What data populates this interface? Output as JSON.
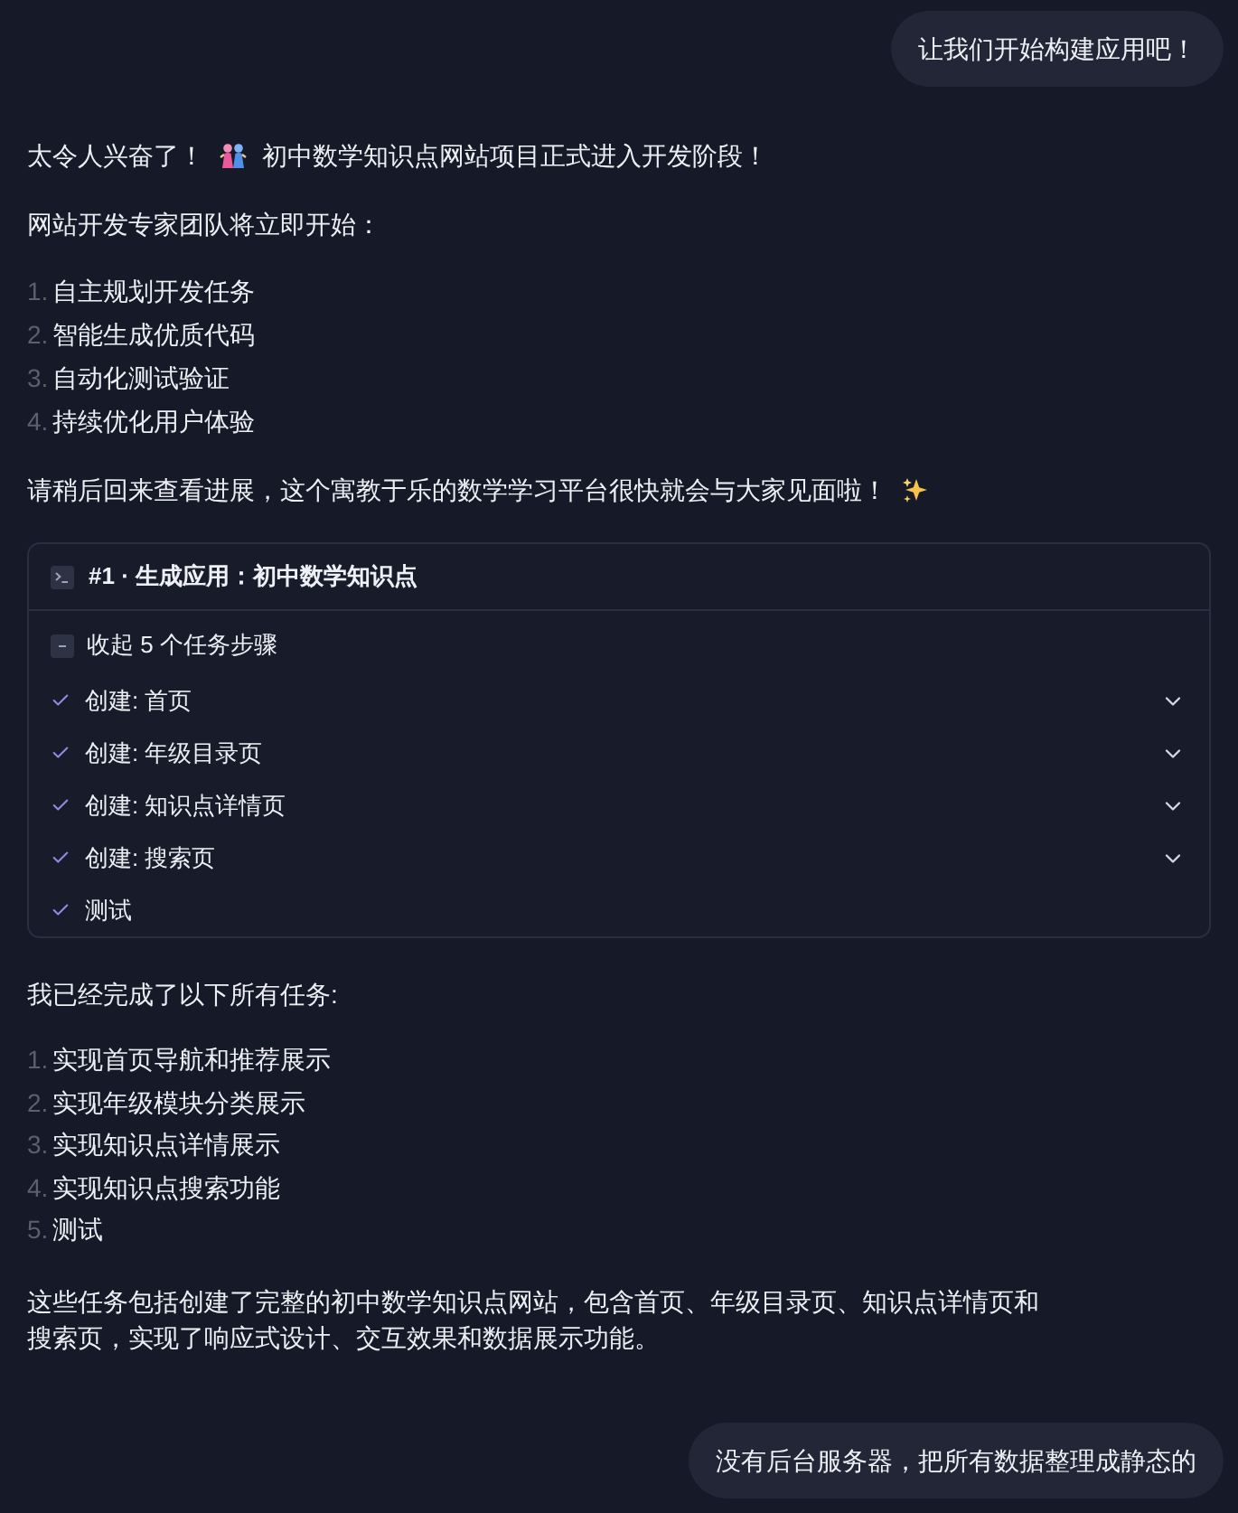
{
  "user_message": {
    "text": "让我们开始构建应用吧！"
  },
  "reply": {
    "intro": {
      "before": "太令人兴奋了！",
      "after": "初中数学知识点网站项目正式进入开发阶段！"
    },
    "team_line": "网站开发专家团队将立即开始：",
    "plan": [
      {
        "number": "1.",
        "text": "自主规划开发任务"
      },
      {
        "number": "2.",
        "text": "智能生成优质代码"
      },
      {
        "number": "3.",
        "text": "自动化测试验证"
      },
      {
        "number": "4.",
        "text": "持续优化用户体验"
      }
    ],
    "outro": "请稍后回来查看进展，这个寓教于乐的数学学习平台很快就会与大家见面啦！"
  },
  "task_card": {
    "title": "#1 · 生成应用：初中数学知识点",
    "toggle": {
      "label": "收起 5 个任务步骤",
      "expanded": true
    },
    "steps": [
      {
        "label": "创建: 首页",
        "done": true,
        "expandable": true
      },
      {
        "label": "创建: 年级目录页",
        "done": true,
        "expandable": true
      },
      {
        "label": "创建: 知识点详情页",
        "done": true,
        "expandable": true
      },
      {
        "label": "创建: 搜索页",
        "done": true,
        "expandable": true
      },
      {
        "label": "测试",
        "done": true,
        "expandable": false
      }
    ]
  },
  "summary": {
    "heading": "我已经完成了以下所有任务:",
    "items": [
      {
        "number": "1.",
        "text": "实现首页导航和推荐展示"
      },
      {
        "number": "2.",
        "text": "实现年级模块分类展示"
      },
      {
        "number": "3.",
        "text": "实现知识点详情展示"
      },
      {
        "number": "4.",
        "text": "实现知识点搜索功能"
      },
      {
        "number": "5.",
        "text": "测试"
      }
    ],
    "paragraph": "这些任务包括创建了完整的初中数学知识点网站，包含首页、年级目录页、知识点详情页和搜索页，实现了响应式设计、交互效果和数据展示功能。"
  },
  "followup_message": {
    "text": "没有后台服务器，把所有数据整理成静态的"
  }
}
